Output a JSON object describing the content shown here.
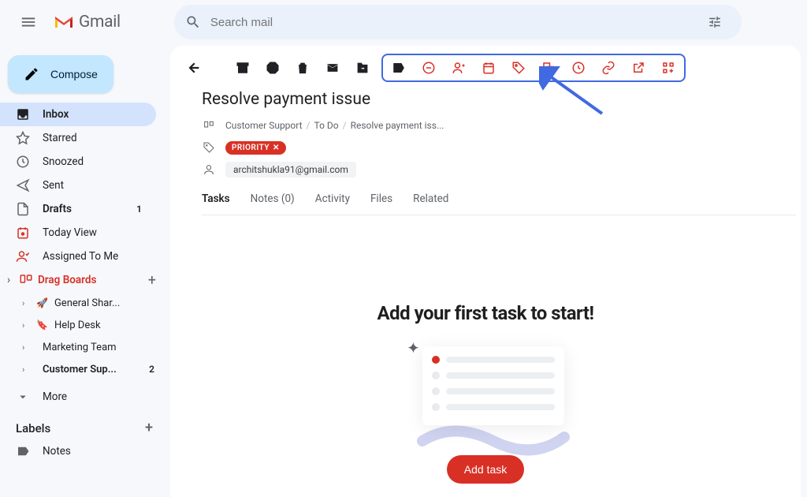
{
  "header": {
    "logo_text": "Gmail",
    "search_placeholder": "Search mail"
  },
  "compose_label": "Compose",
  "sidebar": {
    "items": [
      {
        "label": "Inbox",
        "active": true,
        "bold": true
      },
      {
        "label": "Starred"
      },
      {
        "label": "Snoozed"
      },
      {
        "label": "Sent"
      },
      {
        "label": "Drafts",
        "bold": true,
        "count": "1"
      },
      {
        "label": "Today View"
      },
      {
        "label": "Assigned To Me"
      }
    ],
    "drag_boards_label": "Drag Boards",
    "boards": [
      {
        "emoji": "🚀",
        "label": "General Shar..."
      },
      {
        "emoji": "🔖",
        "label": "Help Desk"
      },
      {
        "emoji": "",
        "label": "Marketing Team"
      },
      {
        "emoji": "",
        "label": "Customer Sup...",
        "bold": true,
        "count": "2"
      }
    ],
    "more_label": "More",
    "labels_header": "Labels",
    "labels": [
      {
        "label": "Notes"
      }
    ]
  },
  "main": {
    "title": "Resolve payment issue",
    "breadcrumb": [
      "Customer Support",
      "To Do",
      "Resolve payment iss..."
    ],
    "priority_chip": "PRIORITY",
    "assignee_email": "architshukla91@gmail.com",
    "tabs": [
      {
        "label": "Tasks",
        "active": true
      },
      {
        "label": "Notes (0)"
      },
      {
        "label": "Activity"
      },
      {
        "label": "Files"
      },
      {
        "label": "Related"
      }
    ],
    "empty_state_title": "Add your first task to start!",
    "add_task_label": "Add task"
  }
}
